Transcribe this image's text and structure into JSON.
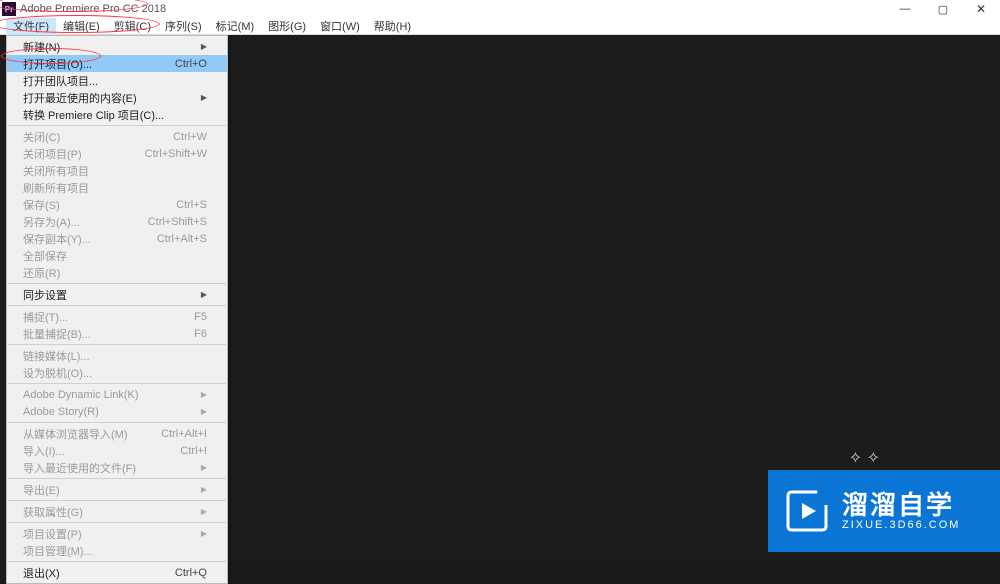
{
  "titlebar": {
    "icon_label": "Pr",
    "title": "Adobe Premiere Pro CC 2018"
  },
  "window_controls": {
    "minimize": "—",
    "maximize": "▢",
    "close": "✕"
  },
  "menubar": [
    "文件(F)",
    "编辑(E)",
    "剪辑(C)",
    "序列(S)",
    "标记(M)",
    "图形(G)",
    "窗口(W)",
    "帮助(H)"
  ],
  "dropdown": [
    {
      "type": "item",
      "label": "新建(N)",
      "submenu": true
    },
    {
      "type": "item",
      "label": "打开项目(O)...",
      "shortcut": "Ctrl+O",
      "highlight": true
    },
    {
      "type": "item",
      "label": "打开团队项目..."
    },
    {
      "type": "item",
      "label": "打开最近使用的内容(E)",
      "submenu": true
    },
    {
      "type": "item",
      "label": "转换 Premiere Clip 项目(C)..."
    },
    {
      "type": "sep"
    },
    {
      "type": "item",
      "label": "关闭(C)",
      "shortcut": "Ctrl+W",
      "disabled": true
    },
    {
      "type": "item",
      "label": "关闭项目(P)",
      "shortcut": "Ctrl+Shift+W",
      "disabled": true
    },
    {
      "type": "item",
      "label": "关闭所有项目",
      "disabled": true
    },
    {
      "type": "item",
      "label": "刷新所有项目",
      "disabled": true
    },
    {
      "type": "item",
      "label": "保存(S)",
      "shortcut": "Ctrl+S",
      "disabled": true
    },
    {
      "type": "item",
      "label": "另存为(A)...",
      "shortcut": "Ctrl+Shift+S",
      "disabled": true
    },
    {
      "type": "item",
      "label": "保存副本(Y)...",
      "shortcut": "Ctrl+Alt+S",
      "disabled": true
    },
    {
      "type": "item",
      "label": "全部保存",
      "disabled": true
    },
    {
      "type": "item",
      "label": "还原(R)",
      "disabled": true
    },
    {
      "type": "sep"
    },
    {
      "type": "item",
      "label": "同步设置",
      "submenu": true
    },
    {
      "type": "sep"
    },
    {
      "type": "item",
      "label": "捕捉(T)...",
      "shortcut": "F5",
      "disabled": true
    },
    {
      "type": "item",
      "label": "批量捕捉(B)...",
      "shortcut": "F6",
      "disabled": true
    },
    {
      "type": "sep"
    },
    {
      "type": "item",
      "label": "链接媒体(L)...",
      "disabled": true
    },
    {
      "type": "item",
      "label": "设为脱机(O)...",
      "disabled": true
    },
    {
      "type": "sep"
    },
    {
      "type": "item",
      "label": "Adobe Dynamic Link(K)",
      "submenu": true,
      "disabled": true
    },
    {
      "type": "item",
      "label": "Adobe Story(R)",
      "submenu": true,
      "disabled": true
    },
    {
      "type": "sep"
    },
    {
      "type": "item",
      "label": "从媒体浏览器导入(M)",
      "shortcut": "Ctrl+Alt+I",
      "disabled": true
    },
    {
      "type": "item",
      "label": "导入(I)...",
      "shortcut": "Ctrl+I",
      "disabled": true
    },
    {
      "type": "item",
      "label": "导入最近使用的文件(F)",
      "submenu": true,
      "disabled": true
    },
    {
      "type": "sep"
    },
    {
      "type": "item",
      "label": "导出(E)",
      "submenu": true,
      "disabled": true
    },
    {
      "type": "sep"
    },
    {
      "type": "item",
      "label": "获取属性(G)",
      "submenu": true,
      "disabled": true
    },
    {
      "type": "sep"
    },
    {
      "type": "item",
      "label": "项目设置(P)",
      "submenu": true,
      "disabled": true
    },
    {
      "type": "item",
      "label": "项目管理(M)...",
      "disabled": true
    },
    {
      "type": "sep"
    },
    {
      "type": "item",
      "label": "退出(X)",
      "shortcut": "Ctrl+Q"
    }
  ],
  "watermark": {
    "main": "溜溜自学",
    "sub": "ZIXUE.3D66.COM"
  }
}
